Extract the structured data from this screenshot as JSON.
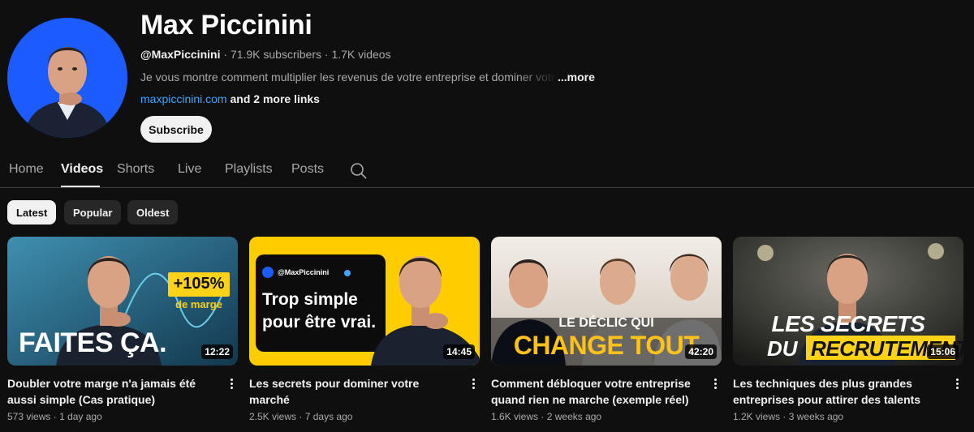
{
  "channel": {
    "name": "Max Piccinini",
    "handle": "@MaxPiccinini",
    "subscribers": "71.9K subscribers",
    "videos_count": "1.7K videos",
    "separator": "·",
    "description": "Je vous montre comment multiplier les revenus de votre entreprise et dominer votre secteur",
    "more_label": "...more",
    "website": "maxpiccinini.com",
    "more_links": "and 2 more links",
    "subscribe_label": "Subscribe"
  },
  "tabs": [
    {
      "label": "Home",
      "active": false
    },
    {
      "label": "Videos",
      "active": true
    },
    {
      "label": "Shorts",
      "active": false
    },
    {
      "label": "Live",
      "active": false
    },
    {
      "label": "Playlists",
      "active": false
    },
    {
      "label": "Posts",
      "active": false
    }
  ],
  "tab_search_icon": "search-icon",
  "chips": [
    {
      "label": "Latest",
      "active": true
    },
    {
      "label": "Popular",
      "active": false
    },
    {
      "label": "Oldest",
      "active": false
    }
  ],
  "videos": [
    {
      "title": "Doubler votre marge n'a jamais été aussi simple (Cas pratique)",
      "duration": "12:22",
      "views": "573 views",
      "age": "1 day ago",
      "thumb_text": {
        "badge": "+105%",
        "badge_sub": "de marge",
        "headline": "FAITES ÇA."
      }
    },
    {
      "title": "Les secrets pour dominer votre marché",
      "duration": "14:45",
      "views": "2.5K views",
      "age": "7 days ago",
      "thumb_text": {
        "handle": "@MaxPiccinini",
        "line1": "Trop simple",
        "line2": "pour être vrai."
      }
    },
    {
      "title": "Comment débloquer votre entreprise quand rien ne marche (exemple réel)",
      "duration": "42:20",
      "views": "1.6K views",
      "age": "2 weeks ago",
      "thumb_text": {
        "line1": "LE DÉCLIC QUI",
        "line2": "CHANGE TOUT"
      }
    },
    {
      "title": "Les techniques des plus grandes entreprises pour attirer des talents",
      "duration": "15:06",
      "views": "1.2K views",
      "age": "3 weeks ago",
      "thumb_text": {
        "line1": "LES SECRETS",
        "line2a": "DU",
        "line2b": "RECRUTEMENT"
      }
    }
  ],
  "colors": {
    "background": "#0f0f0f",
    "link": "#3ea6ff",
    "avatar_bg": "#1c5bff",
    "accent_yellow": "#ffd21a"
  }
}
